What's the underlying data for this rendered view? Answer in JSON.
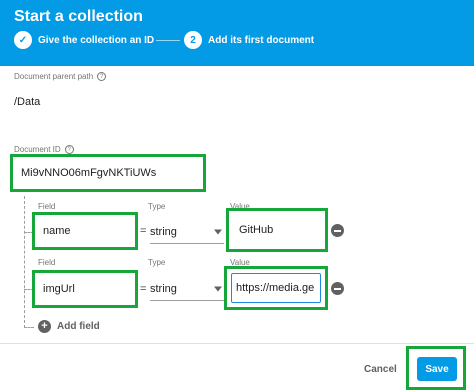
{
  "header": {
    "title": "Start a collection",
    "steps": [
      {
        "number": "✓",
        "label": "Give the collection an ID"
      },
      {
        "number": "2",
        "label": "Add its first document"
      }
    ]
  },
  "document": {
    "parent_path_label": "Document parent path",
    "parent_path_value": "/Data",
    "id_label": "Document ID",
    "id_value": "Mi9vNNO06mFgvNKTiUWs"
  },
  "fields": [
    {
      "field_label": "Field",
      "field": "name",
      "type_label": "Type",
      "type": "string",
      "value_label": "Value",
      "value": "GitHub"
    },
    {
      "field_label": "Field",
      "field": "imgUrl",
      "type_label": "Type",
      "type": "string",
      "value_label": "Value",
      "value": "https://media.ge"
    }
  ],
  "add_field_label": "Add field",
  "equals": "=",
  "help_glyph": "?",
  "add_glyph": "+",
  "footer": {
    "cancel_label": "Cancel",
    "save_label": "Save"
  },
  "colors": {
    "header_bg": "#039be5",
    "highlight": "#17a63a",
    "save_bg": "#039be5"
  }
}
